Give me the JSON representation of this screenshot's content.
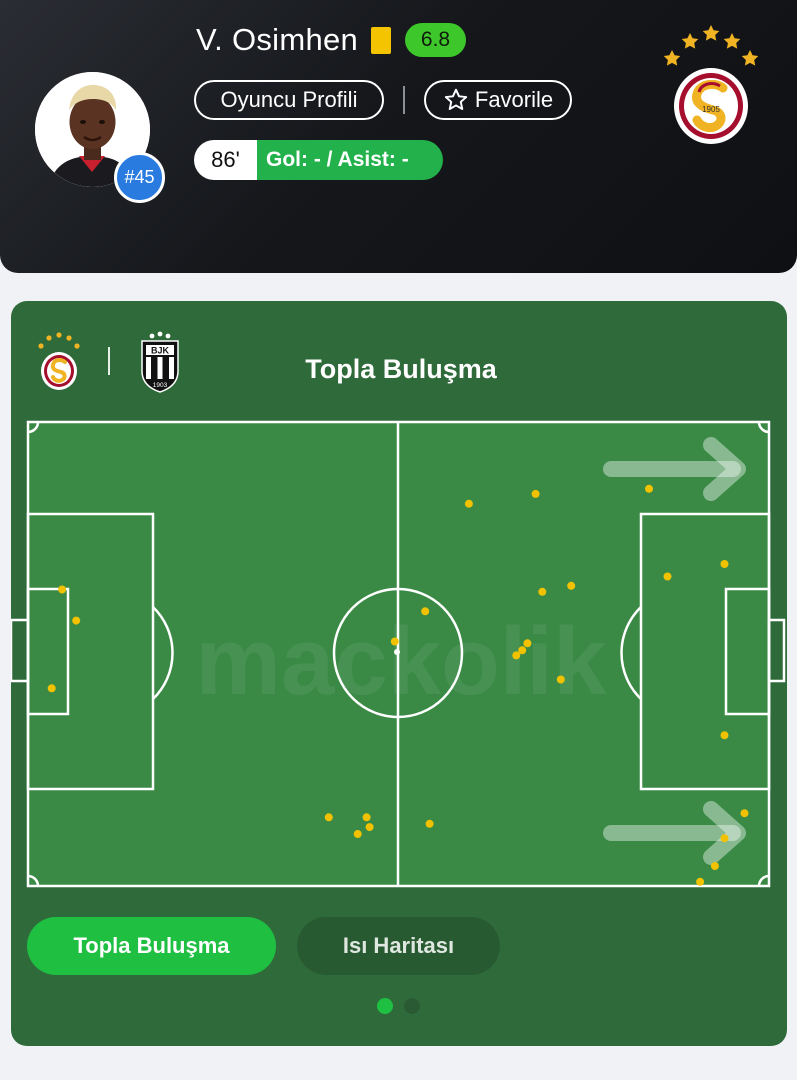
{
  "player": {
    "name": "V. Osimhen",
    "number": "#45",
    "rating": "6.8",
    "card": "yellow",
    "minutes": "86'",
    "goals_assists": "Gol: - / Asist: -",
    "profile_button": "Oyuncu Profili",
    "favorite_button": "Favorile"
  },
  "club": {
    "crest_year": "1905"
  },
  "card": {
    "title": "Topla Buluşma",
    "home_team_icon": "galatasaray-crest",
    "away_team_icon": "besiktas-crest",
    "away_crest_text_top": "BJK",
    "away_crest_year": "1903",
    "watermark": "mackolik"
  },
  "tabs": [
    {
      "label": "Topla Buluşma",
      "active": true
    },
    {
      "label": "Isı Haritası",
      "active": false
    }
  ],
  "pager": {
    "pages": 2,
    "current": 1
  },
  "chart_data": {
    "type": "scatter",
    "title": "Topla Buluşma",
    "xlim": [
      0,
      100
    ],
    "ylim": [
      0,
      100
    ],
    "attack_direction": "right",
    "points": [
      [
        59.5,
        17.6
      ],
      [
        68.5,
        15.5
      ],
      [
        83.8,
        14.4
      ],
      [
        45.7,
        85.2
      ],
      [
        46.1,
        87.3
      ],
      [
        44.5,
        88.8
      ],
      [
        40.6,
        85.2
      ],
      [
        54.2,
        86.6
      ],
      [
        53.6,
        40.8
      ],
      [
        49.5,
        47.3
      ],
      [
        69.4,
        36.6
      ],
      [
        73.3,
        35.3
      ],
      [
        65.9,
        50.3
      ],
      [
        67.4,
        47.7
      ],
      [
        66.7,
        49.2
      ],
      [
        71.9,
        55.5
      ],
      [
        86.3,
        33.3
      ],
      [
        94.0,
        30.6
      ],
      [
        94.0,
        67.5
      ],
      [
        90.7,
        99.1
      ],
      [
        92.7,
        95.7
      ],
      [
        94.0,
        89.7
      ],
      [
        96.7,
        84.3
      ],
      [
        4.6,
        36.1
      ],
      [
        6.5,
        42.8
      ],
      [
        3.2,
        57.4
      ]
    ]
  },
  "colors": {
    "rating_green": "#3ec72b",
    "active_tab": "#1fbf42",
    "number_badge": "#2a7be0",
    "yellow_card": "#f5c400",
    "dot": "#f2c200"
  }
}
